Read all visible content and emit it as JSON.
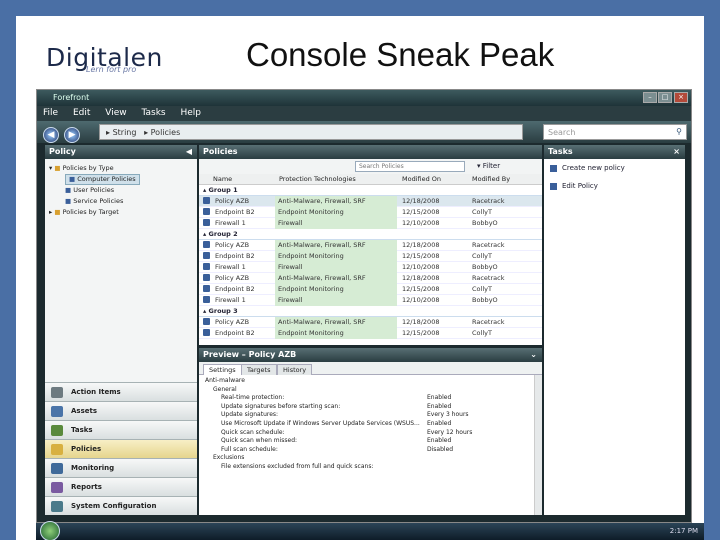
{
  "slide": {
    "logo_text": "Digitalen",
    "logo_tagline": "Lern fort pro",
    "title": "Console Sneak Peak"
  },
  "window": {
    "title": "Forefront",
    "menu": [
      "File",
      "Edit",
      "View",
      "Tasks",
      "Help"
    ],
    "breadcrumb": [
      "String",
      "Policies"
    ],
    "search_placeholder": "Search"
  },
  "left_pane": {
    "header": "Policy",
    "tree": [
      {
        "label": "Policies by Type",
        "level": 0
      },
      {
        "label": "Computer Policies",
        "level": 1,
        "selected": true
      },
      {
        "label": "User Policies",
        "level": 1
      },
      {
        "label": "Service Policies",
        "level": 1
      },
      {
        "label": "Policies by Target",
        "level": 0
      }
    ],
    "nav_sections": [
      {
        "label": "Action Items",
        "color": "#6d7a80"
      },
      {
        "label": "Assets",
        "color": "#4a74a8"
      },
      {
        "label": "Tasks",
        "color": "#5a8a3c"
      },
      {
        "label": "Policies",
        "color": "#d8b040",
        "active": true
      },
      {
        "label": "Monitoring",
        "color": "#3f6a9a"
      },
      {
        "label": "Reports",
        "color": "#7a5aa0"
      },
      {
        "label": "System Configuration",
        "color": "#4a7a8a"
      }
    ]
  },
  "policies_pane": {
    "header": "Policies",
    "filter_placeholder": "Search Policies",
    "filter_label": "Filter",
    "columns": [
      "Name",
      "Protection Technologies",
      "Modified On",
      "Modified By"
    ],
    "groups": [
      {
        "name": "Group 1",
        "rows": [
          {
            "name": "Policy AZB",
            "tech": "Anti-Malware, Firewall, SRF",
            "date": "12/18/2008",
            "by": "Racetrack",
            "selected": true
          },
          {
            "name": "Endpoint B2",
            "tech": "Endpoint Monitoring",
            "date": "12/15/2008",
            "by": "CollyT"
          },
          {
            "name": "Firewall 1",
            "tech": "Firewall",
            "date": "12/10/2008",
            "by": "BobbyO"
          }
        ]
      },
      {
        "name": "Group 2",
        "rows": [
          {
            "name": "Policy AZB",
            "tech": "Anti-Malware, Firewall, SRF",
            "date": "12/18/2008",
            "by": "Racetrack"
          },
          {
            "name": "Endpoint B2",
            "tech": "Endpoint Monitoring",
            "date": "12/15/2008",
            "by": "CollyT"
          },
          {
            "name": "Firewall 1",
            "tech": "Firewall",
            "date": "12/10/2008",
            "by": "BobbyO"
          },
          {
            "name": "Policy AZB",
            "tech": "Anti-Malware, Firewall, SRF",
            "date": "12/18/2008",
            "by": "Racetrack"
          },
          {
            "name": "Endpoint B2",
            "tech": "Endpoint Monitoring",
            "date": "12/15/2008",
            "by": "CollyT"
          },
          {
            "name": "Firewall 1",
            "tech": "Firewall",
            "date": "12/10/2008",
            "by": "BobbyO"
          }
        ]
      },
      {
        "name": "Group 3",
        "rows": [
          {
            "name": "Policy AZB",
            "tech": "Anti-Malware, Firewall, SRF",
            "date": "12/18/2008",
            "by": "Racetrack"
          },
          {
            "name": "Endpoint B2",
            "tech": "Endpoint Monitoring",
            "date": "12/15/2008",
            "by": "CollyT"
          }
        ]
      }
    ]
  },
  "preview_pane": {
    "header": "Preview – Policy AZB",
    "tabs": [
      "Settings",
      "Targets",
      "History"
    ],
    "active_tab": "Settings",
    "lines": [
      {
        "label": "Anti-malware",
        "value": "",
        "indent": 0
      },
      {
        "label": "General",
        "value": "",
        "indent": 1
      },
      {
        "label": "Real-time protection:",
        "value": "Enabled",
        "indent": 2
      },
      {
        "label": "Update signatures before starting scan:",
        "value": "Enabled",
        "indent": 2
      },
      {
        "label": "Update signatures:",
        "value": "Every 3 hours",
        "indent": 2
      },
      {
        "label": "Use Microsoft Update if Windows Server Update Services (WSUS...",
        "value": "Enabled",
        "indent": 2
      },
      {
        "label": "Quick scan schedule:",
        "value": "Every 12 hours",
        "indent": 2
      },
      {
        "label": "Quick scan when missed:",
        "value": "Enabled",
        "indent": 2
      },
      {
        "label": "Full scan schedule:",
        "value": "Disabled",
        "indent": 2
      },
      {
        "label": "Exclusions",
        "value": "",
        "indent": 1
      },
      {
        "label": "File extensions excluded from full and quick scans:",
        "value": "",
        "indent": 2
      }
    ]
  },
  "tasks_pane": {
    "header": "Tasks",
    "items": [
      "Create new policy",
      "Edit Policy"
    ]
  },
  "taskbar": {
    "clock": "2:17 PM"
  }
}
